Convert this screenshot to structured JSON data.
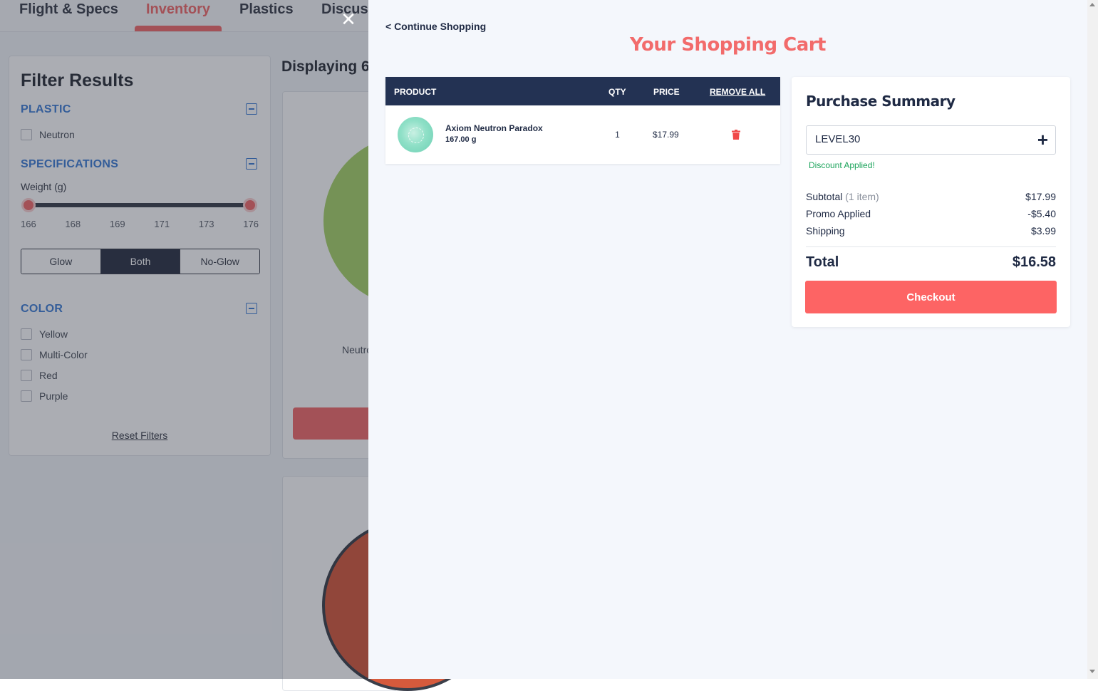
{
  "nav": {
    "tabs": [
      {
        "label": "Flight & Specs"
      },
      {
        "label": "Inventory"
      },
      {
        "label": "Plastics"
      },
      {
        "label": "Discus"
      }
    ]
  },
  "filters": {
    "title": "Filter Results",
    "plastic": {
      "heading": "PLASTIC",
      "options": [
        "Neutron"
      ]
    },
    "specifications": {
      "heading": "SPECIFICATIONS",
      "weight_label": "Weight (g)",
      "ticks": [
        "166",
        "168",
        "169",
        "171",
        "173",
        "176"
      ],
      "glow_options": [
        "Glow",
        "Both",
        "No-Glow"
      ],
      "glow_selected": "Both"
    },
    "color": {
      "heading": "COLOR",
      "options": [
        "Yellow",
        "Multi-Color",
        "Red",
        "Purple"
      ]
    },
    "reset_label": "Reset Filters"
  },
  "listing": {
    "displaying": "Displaying 6",
    "card_text": "Neutro"
  },
  "cart": {
    "continue_label": "< Continue Shopping",
    "title": "Your Shopping Cart",
    "columns": {
      "product": "PRODUCT",
      "qty": "QTY",
      "price": "PRICE",
      "remove_all": "REMOVE ALL"
    },
    "items": [
      {
        "name": "Axiom Neutron Paradox",
        "weight": "167.00 g",
        "qty": "1",
        "price": "$17.99"
      }
    ]
  },
  "summary": {
    "title": "Purchase Summary",
    "promo_code": "LEVEL30",
    "discount_message": "Discount Applied!",
    "subtotal_label": "Subtotal",
    "subtotal_count": "(1 item)",
    "subtotal_value": "$17.99",
    "promo_label": "Promo Applied",
    "promo_value": "-$5.40",
    "shipping_label": "Shipping",
    "shipping_value": "$3.99",
    "total_label": "Total",
    "total_value": "$16.58",
    "checkout_label": "Checkout"
  },
  "colors": {
    "accent": "#f26b6b",
    "header_navy": "#233253",
    "checkout": "#fd6464",
    "success": "#1aa35a"
  }
}
